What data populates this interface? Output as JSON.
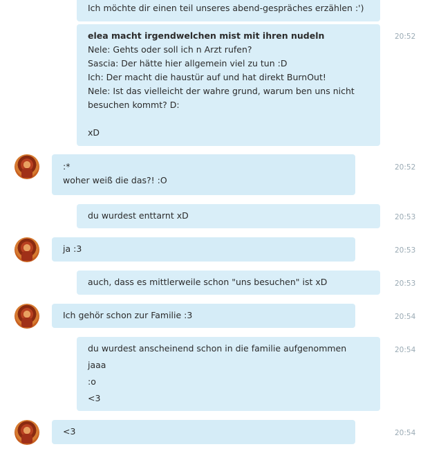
{
  "messages": [
    {
      "id": "m0",
      "lines": [
        "Ich möchte dir einen teil unseres abend-gespräches erzählen :')"
      ],
      "time": ""
    },
    {
      "id": "m1",
      "lines": [
        "elea macht irgendwelchen mist mit ihren nudeln",
        "Nele: Gehts oder soll ich n Arzt rufen?",
        "Sascia: Der hätte hier allgemein viel zu tun :D",
        "Ich: Der macht die haustür auf und hat direkt BurnOut!",
        "Nele: Ist das vielleicht der wahre grund, warum ben uns nicht",
        "besuchen kommt? D:",
        "",
        "xD"
      ],
      "time": "20:52"
    },
    {
      "id": "m2",
      "lines": [
        ":*",
        "woher weiß die das?! :O"
      ],
      "time": "20:52"
    },
    {
      "id": "m3",
      "lines": [
        "du wurdest enttarnt xD"
      ],
      "time": "20:53"
    },
    {
      "id": "m4",
      "lines": [
        "ja :3"
      ],
      "time": "20:53"
    },
    {
      "id": "m5",
      "lines": [
        "auch, dass es mittlerweile schon \"uns besuchen\" ist xD"
      ],
      "time": "20:53"
    },
    {
      "id": "m6",
      "lines": [
        "Ich gehör schon zur Familie :3"
      ],
      "time": "20:54"
    },
    {
      "id": "m7",
      "lines": [
        "du wurdest anscheinend schon in die familie aufgenommen",
        "jaaa",
        ":o",
        "<3"
      ],
      "time": "20:54"
    },
    {
      "id": "m8",
      "lines": [
        "<3"
      ],
      "time": "20:54"
    }
  ]
}
